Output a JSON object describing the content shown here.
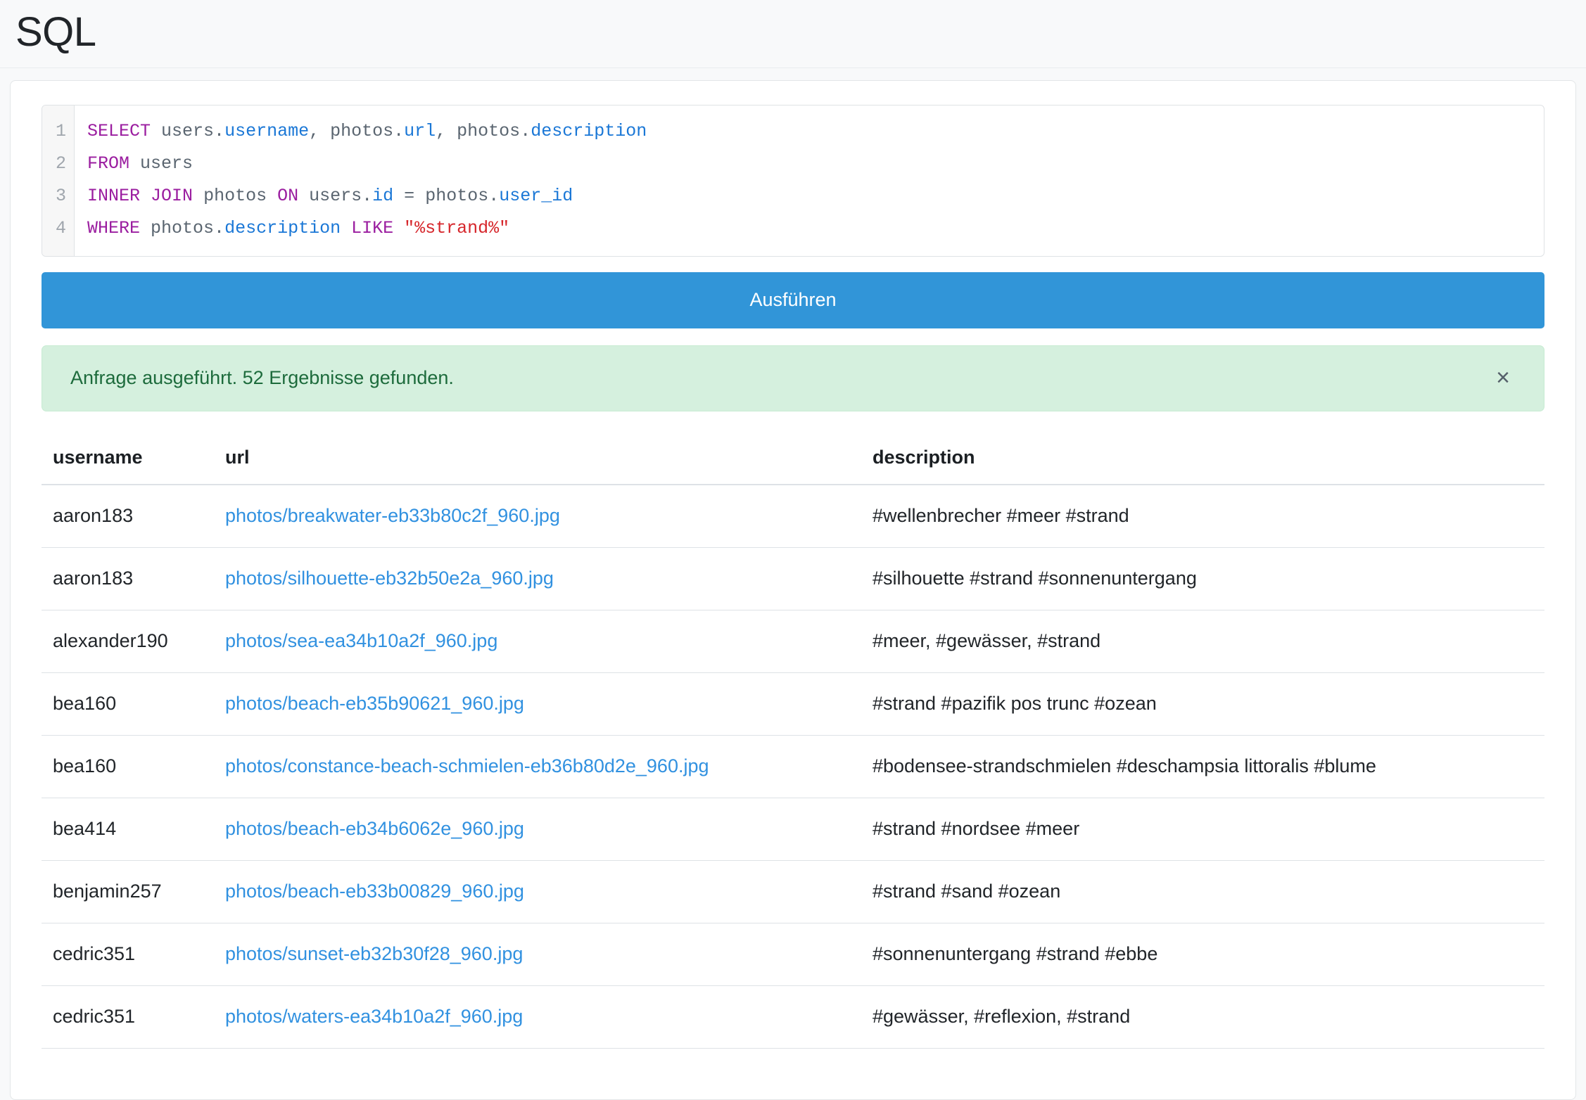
{
  "header": {
    "title": "SQL"
  },
  "editor": {
    "line_numbers": [
      "1",
      "2",
      "3",
      "4"
    ],
    "lines": [
      [
        {
          "t": "SELECT",
          "c": "kw"
        },
        {
          "t": " ",
          "c": "plain"
        },
        {
          "t": "users",
          "c": "plain"
        },
        {
          "t": ".",
          "c": "punct"
        },
        {
          "t": "username",
          "c": "attr"
        },
        {
          "t": ", ",
          "c": "punct"
        },
        {
          "t": "photos",
          "c": "plain"
        },
        {
          "t": ".",
          "c": "punct"
        },
        {
          "t": "url",
          "c": "attr"
        },
        {
          "t": ", ",
          "c": "punct"
        },
        {
          "t": "photos",
          "c": "plain"
        },
        {
          "t": ".",
          "c": "punct"
        },
        {
          "t": "description",
          "c": "attr"
        }
      ],
      [
        {
          "t": "FROM",
          "c": "kw"
        },
        {
          "t": " ",
          "c": "plain"
        },
        {
          "t": "users",
          "c": "plain"
        }
      ],
      [
        {
          "t": "INNER",
          "c": "kw"
        },
        {
          "t": " ",
          "c": "plain"
        },
        {
          "t": "JOIN",
          "c": "kw"
        },
        {
          "t": " ",
          "c": "plain"
        },
        {
          "t": "photos",
          "c": "plain"
        },
        {
          "t": " ",
          "c": "plain"
        },
        {
          "t": "ON",
          "c": "kw"
        },
        {
          "t": " ",
          "c": "plain"
        },
        {
          "t": "users",
          "c": "plain"
        },
        {
          "t": ".",
          "c": "punct"
        },
        {
          "t": "id",
          "c": "attr"
        },
        {
          "t": " = ",
          "c": "op"
        },
        {
          "t": "photos",
          "c": "plain"
        },
        {
          "t": ".",
          "c": "punct"
        },
        {
          "t": "user_id",
          "c": "attr"
        }
      ],
      [
        {
          "t": "WHERE",
          "c": "kw"
        },
        {
          "t": " ",
          "c": "plain"
        },
        {
          "t": "photos",
          "c": "plain"
        },
        {
          "t": ".",
          "c": "punct"
        },
        {
          "t": "description",
          "c": "attr"
        },
        {
          "t": " ",
          "c": "plain"
        },
        {
          "t": "LIKE",
          "c": "kw"
        },
        {
          "t": " ",
          "c": "plain"
        },
        {
          "t": "\"%strand%\"",
          "c": "str"
        }
      ]
    ],
    "plain_text": "SELECT users.username, photos.url, photos.description\nFROM users\nINNER JOIN photos ON users.id = photos.user_id\nWHERE photos.description LIKE \"%strand%\""
  },
  "run_button": {
    "label": "Ausführen"
  },
  "alert": {
    "message": "Anfrage ausgeführt. 52 Ergebnisse gefunden.",
    "close_label": "×",
    "result_count": 52,
    "background_color": "#d5f0de",
    "text_color": "#1d6b3c"
  },
  "results": {
    "columns": [
      "username",
      "url",
      "description"
    ],
    "rows": [
      {
        "username": "aaron183",
        "url": "photos/breakwater-eb33b80c2f_960.jpg",
        "description": "#wellenbrecher #meer #strand"
      },
      {
        "username": "aaron183",
        "url": "photos/silhouette-eb32b50e2a_960.jpg",
        "description": "#silhouette #strand #sonnenuntergang"
      },
      {
        "username": "alexander190",
        "url": "photos/sea-ea34b10a2f_960.jpg",
        "description": "#meer, #gewässer, #strand"
      },
      {
        "username": "bea160",
        "url": "photos/beach-eb35b90621_960.jpg",
        "description": "#strand #pazifik pos trunc #ozean"
      },
      {
        "username": "bea160",
        "url": "photos/constance-beach-schmielen-eb36b80d2e_960.jpg",
        "description": "#bodensee-strandschmielen #deschampsia littoralis #blume"
      },
      {
        "username": "bea414",
        "url": "photos/beach-eb34b6062e_960.jpg",
        "description": "#strand #nordsee #meer"
      },
      {
        "username": "benjamin257",
        "url": "photos/beach-eb33b00829_960.jpg",
        "description": "#strand #sand #ozean"
      },
      {
        "username": "cedric351",
        "url": "photos/sunset-eb32b30f28_960.jpg",
        "description": "#sonnenuntergang #strand #ebbe"
      },
      {
        "username": "cedric351",
        "url": "photos/waters-ea34b10a2f_960.jpg",
        "description": "#gewässer, #reflexion, #strand"
      }
    ]
  },
  "colors": {
    "page_background": "#f8f9fa",
    "card_background": "#ffffff",
    "primary_button": "#3195d8",
    "link": "#3191e0",
    "keyword": "#9b1ea0",
    "attribute": "#1a77d6",
    "string": "#d6262b"
  }
}
